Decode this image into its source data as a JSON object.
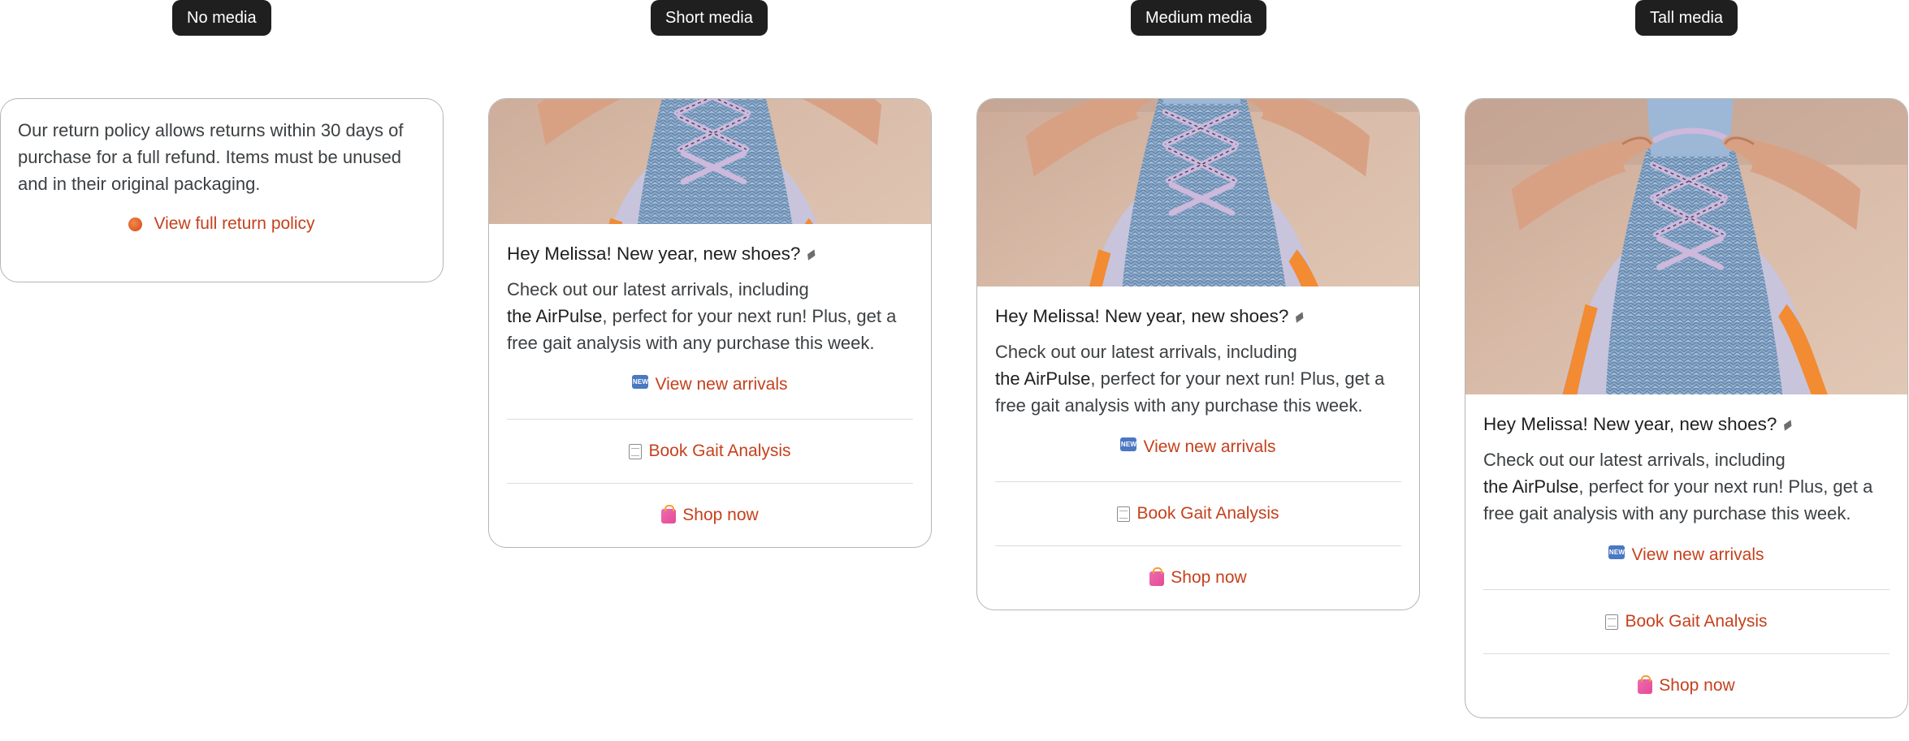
{
  "columns": [
    {
      "label": "No media"
    },
    {
      "label": "Short media"
    },
    {
      "label": "Medium media"
    },
    {
      "label": "Tall media"
    }
  ],
  "policy_card": {
    "text": "Our return policy allows returns within 30 days of purchase for a full refund. Items must be unused and in their original packaging.",
    "link_icon": "globe-icon",
    "link_label": "View full return policy"
  },
  "promo_card": {
    "title": "Hey Melissa! New year, new shoes?",
    "title_icon": "running-shoe-icon",
    "body_line1": "Check out our latest arrivals, including",
    "body_strong": "the AirPulse",
    "body_rest": ", perfect for your next run! Plus, get a free gait analysis with any purchase this week.",
    "image_alt": "hands tying laces of a blue running shoe",
    "actions": [
      {
        "icon": "new-badge-icon",
        "label": "View new arrivals"
      },
      {
        "icon": "memo-icon",
        "label": "Book Gait Analysis"
      },
      {
        "icon": "shopping-bag-icon",
        "label": "Shop now"
      }
    ]
  },
  "colors": {
    "accent": "#c5411d",
    "label_bg": "#1f1f1f",
    "card_border": "#b5b5b5",
    "divider": "#dadce0"
  }
}
